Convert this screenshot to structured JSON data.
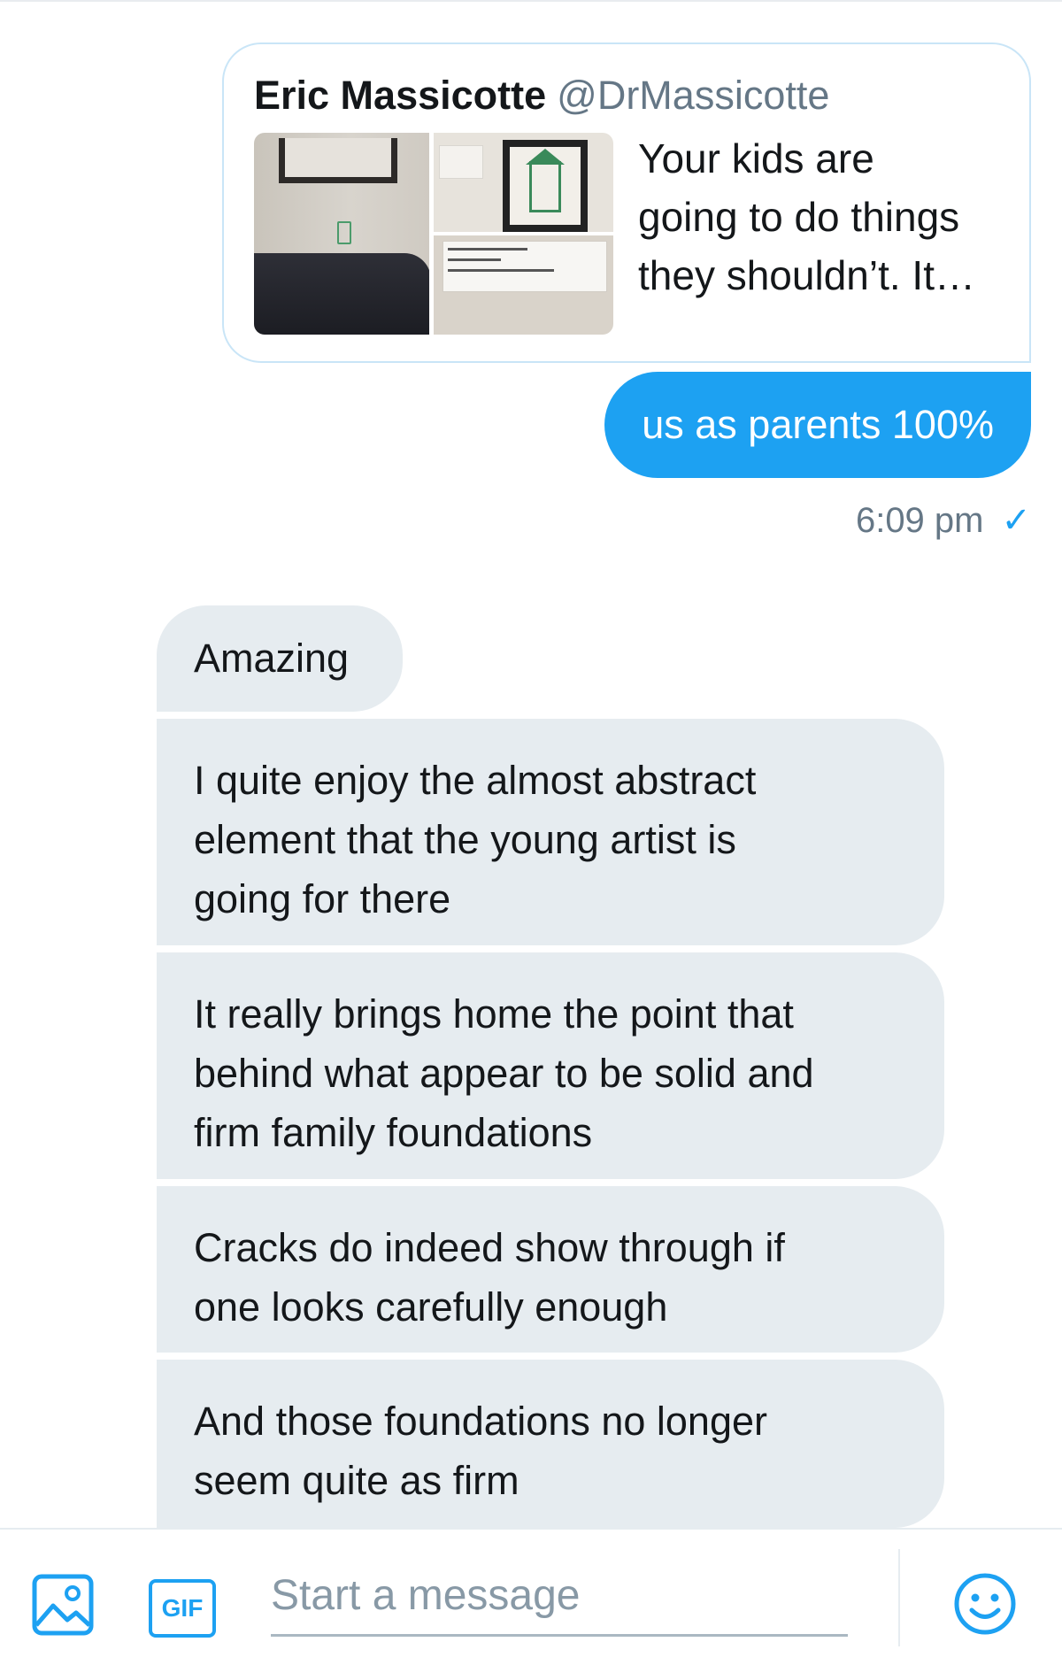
{
  "shared_tweet": {
    "author_name": "Eric Massicotte",
    "author_handle": "@DrMassicotte",
    "text_lines": [
      "Your kids are",
      "going to do things",
      "they shouldn’t. It…"
    ]
  },
  "outgoing": {
    "text": "us as parents 100%",
    "time": "6:09 pm",
    "status_icon": "check-icon",
    "bubble_color": "#1da1f2"
  },
  "incoming": [
    {
      "lines": [
        "Amazing"
      ]
    },
    {
      "lines": [
        "I quite enjoy the almost abstract",
        "element that the young artist is",
        "going for there"
      ]
    },
    {
      "lines": [
        "It really brings home the point that",
        "behind what appear to be solid and",
        "firm family foundations"
      ]
    },
    {
      "lines": [
        "Cracks do indeed show through if",
        "one looks carefully enough"
      ]
    },
    {
      "lines": [
        "And those foundations no longer",
        "seem quite as firm"
      ]
    }
  ],
  "composer": {
    "media_icon": "image-icon",
    "gif_label": "GIF",
    "placeholder": "Start a message",
    "emoji_icon": "smiley-icon"
  },
  "colors": {
    "accent": "#1da1f2",
    "incoming_bubble": "#e6ecf0",
    "muted_text": "#657786"
  }
}
